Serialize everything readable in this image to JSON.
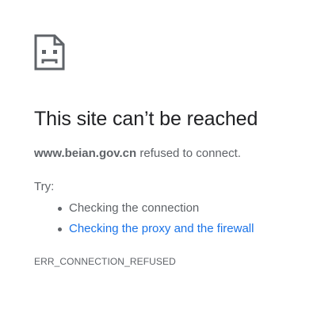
{
  "icon": "sad-page-icon",
  "title": "This site can’t be reached",
  "summary": {
    "host": "www.beian.gov.cn",
    "message": " refused to connect."
  },
  "try_label": "Try:",
  "suggestions": [
    {
      "text": "Checking the connection",
      "is_link": false
    },
    {
      "text": "Checking the proxy and the firewall",
      "is_link": true
    }
  ],
  "error_code": "ERR_CONNECTION_REFUSED",
  "colors": {
    "title_text": "#202124",
    "body_text": "#5f6368",
    "link": "#1a73e8",
    "icon": "#5f6368"
  }
}
